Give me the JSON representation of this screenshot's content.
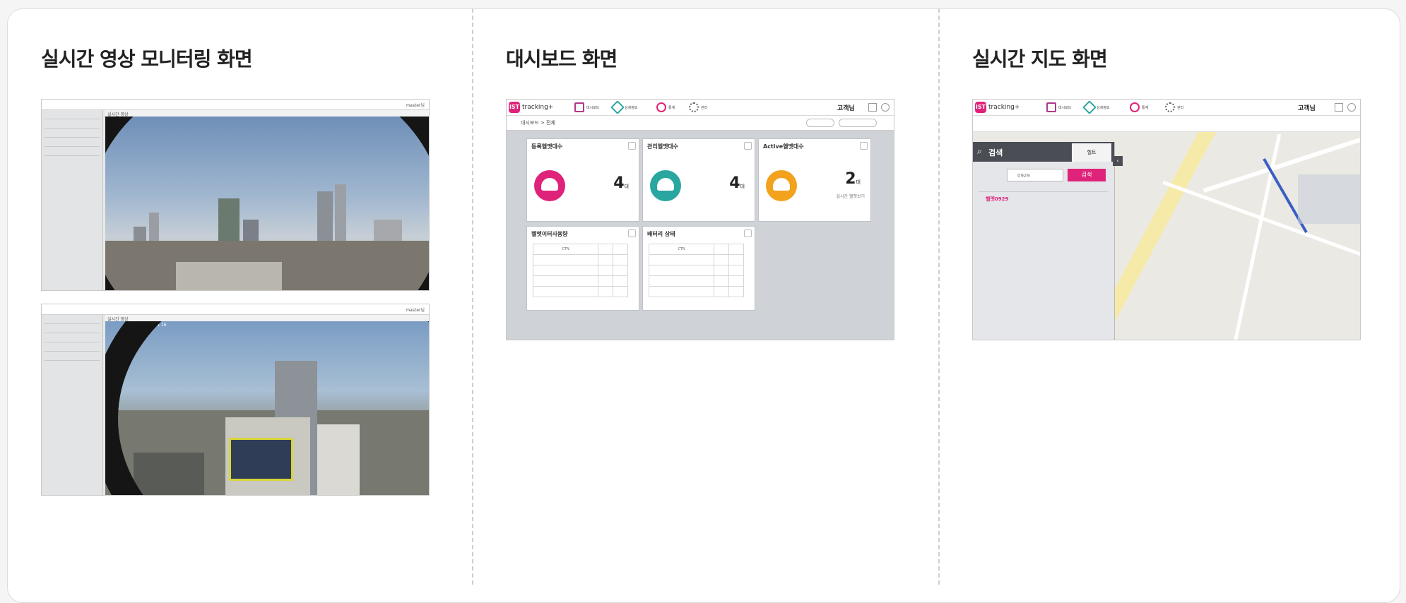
{
  "columns": [
    {
      "title": "실시간 영상 모니터링 화면"
    },
    {
      "title": "대시보드 화면"
    },
    {
      "title": "실시간 지도 화면"
    }
  ],
  "monitor": {
    "top_right": "master님",
    "cam1_title": "실시간 영상",
    "cam2_title": "실시간 영상",
    "cam2_timestamp": "11 21 16"
  },
  "dashboard": {
    "logo": "IST",
    "logo_text": "tracking+",
    "nav": [
      "대시보드",
      "상세정보",
      "통계",
      "관리"
    ],
    "user": "고객님",
    "breadcrumb": "대시보드 > 전체",
    "tiles": [
      {
        "title": "등록헬멧대수",
        "value": "4",
        "unit": "대",
        "color": "#e0237a"
      },
      {
        "title": "관리헬멧대수",
        "value": "4",
        "unit": "대",
        "color": "#2aa6a0"
      },
      {
        "title": "Active헬멧대수",
        "value": "2",
        "unit": "대",
        "sub": "실시간 헬멧보기",
        "color": "#f2a21c"
      }
    ],
    "tables": [
      {
        "title": "헬멧이터사용량",
        "rows": [
          "CTN",
          "",
          "",
          "",
          ""
        ]
      },
      {
        "title": "배터리 상태",
        "rows": [
          "CTN",
          "",
          "",
          "",
          ""
        ]
      }
    ]
  },
  "map": {
    "logo": "IST",
    "logo_text": "tracking+",
    "nav": [
      "대시보드",
      "상세정보",
      "통계",
      "관리"
    ],
    "user": "고객님",
    "search_title": "검색",
    "tab": "헬트",
    "input_value": "0929",
    "search_button": "검색",
    "result": "헬멧0929"
  }
}
